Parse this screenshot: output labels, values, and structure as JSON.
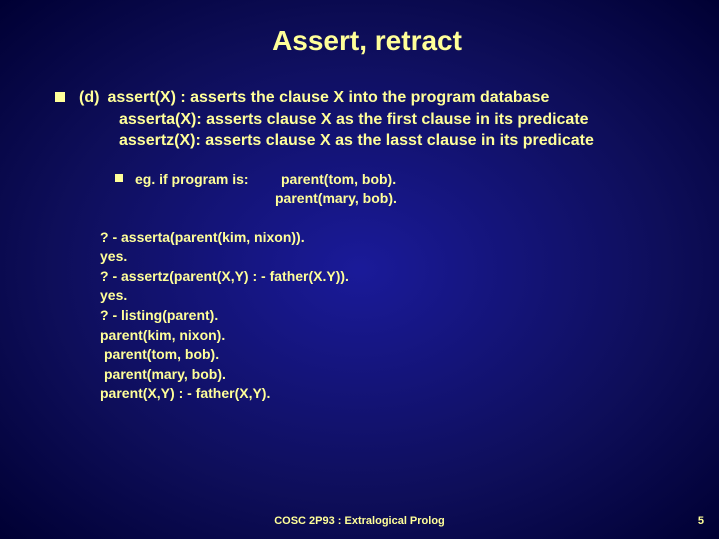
{
  "title": "Assert, retract",
  "main": {
    "label": "(d)",
    "line1": "assert(X) : asserts the clause X into the program database",
    "line2": "asserta(X): asserts clause X as the first clause in its predicate",
    "line3": "assertz(X): asserts clause X as the lasst clause in its predicate"
  },
  "eg": {
    "intro": "eg. if program is:",
    "p1": "parent(tom, bob).",
    "p2": "parent(mary, bob)."
  },
  "example": [
    "? -  asserta(parent(kim, nixon)).",
    "yes.",
    "? - assertz(parent(X,Y) : - father(X.Y)).",
    "yes.",
    "? - listing(parent).",
    "parent(kim, nixon).",
    " parent(tom, bob).",
    " parent(mary, bob).",
    "parent(X,Y) : - father(X,Y)."
  ],
  "footer": "COSC 2P93 : Extralogical Prolog",
  "page": "5"
}
